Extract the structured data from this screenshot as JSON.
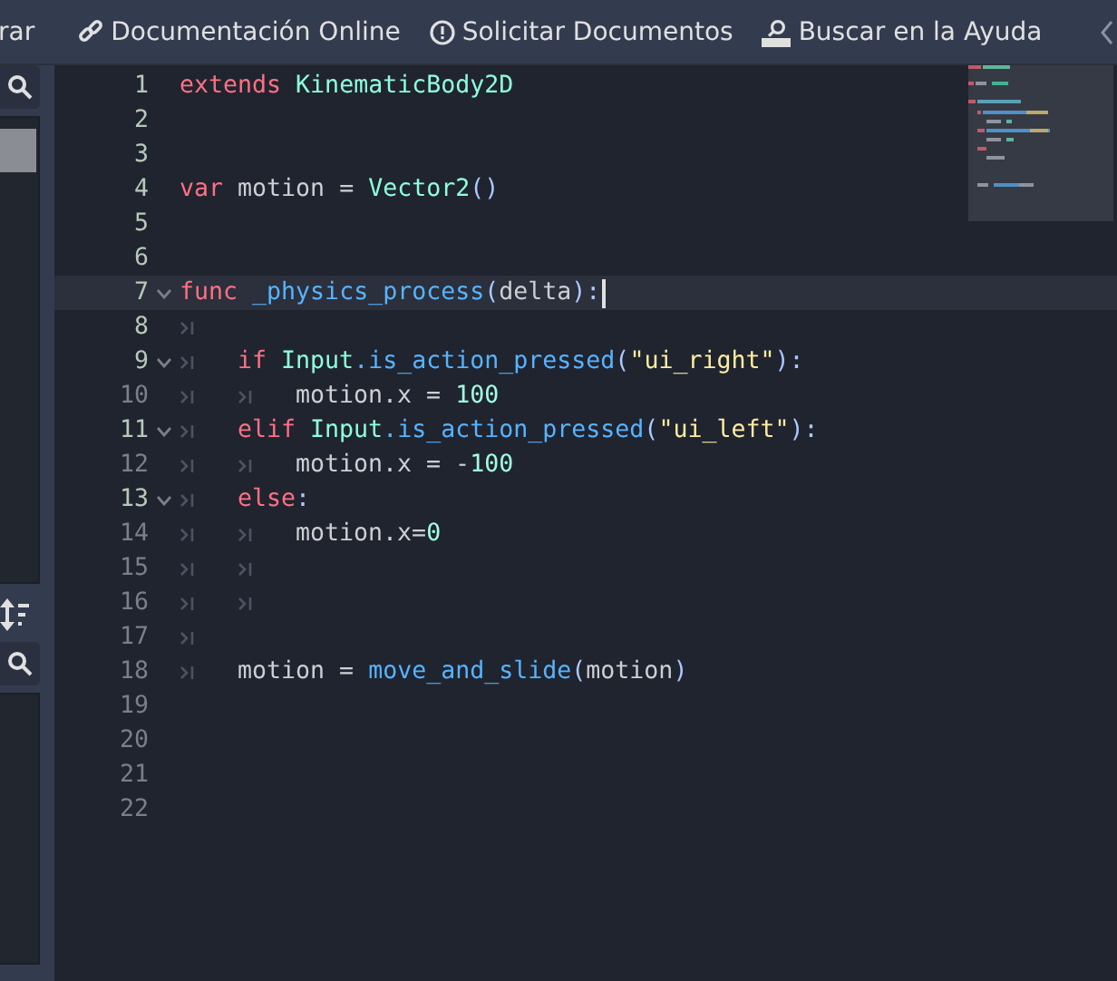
{
  "toolbar": {
    "cut_label": "rar",
    "buttons": [
      {
        "kind": "link",
        "label": "Documentación Online"
      },
      {
        "kind": "alert",
        "label": "Solicitar Documentos"
      },
      {
        "kind": "doc",
        "label": "Buscar en la Ayuda"
      }
    ]
  },
  "editor": {
    "lines": [
      {
        "number": "1",
        "marked": true,
        "tokens": [
          {
            "kind": "keyword",
            "text": "extends "
          },
          {
            "kind": "type",
            "text": "KinematicBody2D"
          }
        ]
      },
      {
        "number": "2",
        "marked": true
      },
      {
        "number": "3",
        "marked": true
      },
      {
        "number": "4",
        "marked": true,
        "tokens": [
          {
            "kind": "keyword",
            "text": "var "
          },
          {
            "kind": "plain",
            "text": "motion = "
          },
          {
            "kind": "type",
            "text": "Vector2"
          },
          {
            "kind": "symbol",
            "text": "()"
          }
        ]
      },
      {
        "number": "5",
        "marked": true
      },
      {
        "number": "6",
        "marked": true
      },
      {
        "number": "7",
        "marked": true,
        "foldable": true,
        "current": true,
        "cursor": true,
        "tokens": [
          {
            "kind": "keyword",
            "text": "func "
          },
          {
            "kind": "function",
            "text": "_physics_process"
          },
          {
            "kind": "symbol",
            "text": "("
          },
          {
            "kind": "plain",
            "text": "delta"
          },
          {
            "kind": "symbol",
            "text": "):"
          }
        ]
      },
      {
        "number": "8",
        "marked": true,
        "tab_marks": [
          {
            "kind": "tab"
          }
        ]
      },
      {
        "number": "9",
        "marked": true,
        "foldable": true,
        "tab_marks": [
          {
            "kind": "tab"
          }
        ],
        "tokens": [
          {
            "kind": "keyword",
            "text": "if "
          },
          {
            "kind": "type",
            "text": "Input"
          },
          {
            "kind": "function",
            "text": ".is_action_pressed"
          },
          {
            "kind": "symbol",
            "text": "("
          },
          {
            "kind": "string",
            "text": "\"ui_right\""
          },
          {
            "kind": "symbol",
            "text": "):"
          }
        ]
      },
      {
        "number": "10",
        "marked": false,
        "tab_marks": [
          {
            "kind": "tab"
          },
          {
            "kind": "tab"
          }
        ],
        "tokens": [
          {
            "kind": "plain",
            "text": "motion.x = "
          },
          {
            "kind": "number",
            "text": "100"
          }
        ]
      },
      {
        "number": "11",
        "marked": true,
        "foldable": true,
        "tab_marks": [
          {
            "kind": "tab"
          }
        ],
        "tokens": [
          {
            "kind": "keyword",
            "text": "elif "
          },
          {
            "kind": "type",
            "text": "Input"
          },
          {
            "kind": "function",
            "text": ".is_action_pressed"
          },
          {
            "kind": "symbol",
            "text": "("
          },
          {
            "kind": "string",
            "text": "\"ui_left\""
          },
          {
            "kind": "symbol",
            "text": "):"
          }
        ]
      },
      {
        "number": "12",
        "marked": false,
        "tab_marks": [
          {
            "kind": "tab"
          },
          {
            "kind": "tab"
          }
        ],
        "tokens": [
          {
            "kind": "plain",
            "text": "motion.x = -"
          },
          {
            "kind": "number",
            "text": "100"
          }
        ]
      },
      {
        "number": "13",
        "marked": true,
        "foldable": true,
        "tab_marks": [
          {
            "kind": "tab"
          }
        ],
        "tokens": [
          {
            "kind": "keyword",
            "text": "else"
          },
          {
            "kind": "symbol",
            "text": ":"
          }
        ]
      },
      {
        "number": "14",
        "marked": false,
        "tab_marks": [
          {
            "kind": "tab"
          },
          {
            "kind": "tab"
          }
        ],
        "tokens": [
          {
            "kind": "plain",
            "text": "motion.x="
          },
          {
            "kind": "number",
            "text": "0"
          }
        ]
      },
      {
        "number": "15",
        "marked": false,
        "tab_marks": [
          {
            "kind": "tab"
          },
          {
            "kind": "tab"
          }
        ]
      },
      {
        "number": "16",
        "marked": false,
        "tab_marks": [
          {
            "kind": "tab"
          },
          {
            "kind": "tab"
          }
        ]
      },
      {
        "number": "17",
        "marked": false,
        "tab_marks": [
          {
            "kind": "tab"
          }
        ]
      },
      {
        "number": "18",
        "marked": false,
        "tab_marks": [
          {
            "kind": "tab"
          }
        ],
        "tokens": [
          {
            "kind": "plain",
            "text": "motion = "
          },
          {
            "kind": "function",
            "text": "move_and_slide"
          },
          {
            "kind": "symbol",
            "text": "("
          },
          {
            "kind": "plain",
            "text": "motion"
          },
          {
            "kind": "symbol",
            "text": ")"
          }
        ]
      },
      {
        "number": "19",
        "marked": false
      },
      {
        "number": "20",
        "marked": false
      },
      {
        "number": "21",
        "marked": false
      },
      {
        "number": "22",
        "marked": false
      }
    ]
  }
}
